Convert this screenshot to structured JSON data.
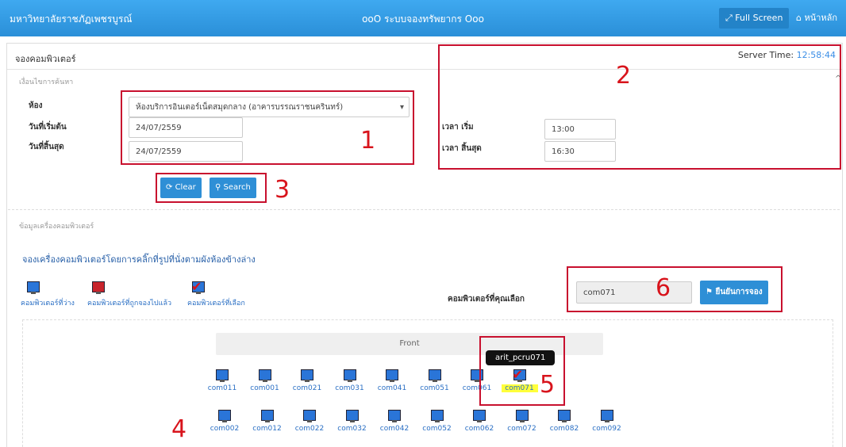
{
  "topbar": {
    "brand": "มหาวิทยาลัยราชภัฏเพชรบูรณ์",
    "title": "ooO ระบบจองทรัพยากร Ooo",
    "fullscreen": "Full Screen",
    "home": "หน้าหลัก",
    "color": "#3399e8"
  },
  "panel": {
    "heading": "จองคอมพิวเตอร์",
    "server_label": "Server Time:",
    "server_time": "12:58:44"
  },
  "search": {
    "section_title": "เงื่อนไขการค้นหา",
    "room_label": "ห้อง",
    "room_value": "ห้องบริการอินเตอร์เน็ตสมุดกลาง (อาคารบรรณราชนครินทร์)",
    "start_date_label": "วันที่เริ่มต้น",
    "start_date": "24/07/2559",
    "end_date_label": "วันที่สิ้นสุด",
    "end_date": "24/07/2559",
    "start_time_label": "เวลา เริ่ม",
    "start_time": "13:00",
    "end_time_label": "เวลา สิ้นสุด",
    "end_time": "16:30",
    "clear": "Clear",
    "search": "Search"
  },
  "annotations": [
    "1",
    "2",
    "3",
    "4",
    "5",
    "6"
  ],
  "computers": {
    "section_title": "ข้อมูลเครื่องคอมพิวเตอร์",
    "instruction": "จองเครื่องคอมพิวเตอร์โดยการคลิ๊กที่รูปที่นั่งตามผังห้องข้างล่าง",
    "legend": [
      "คอมพิวเตอร์ที่ว่าง",
      "คอมพิวเตอร์ที่ถูกจองไปแล้ว",
      "คอมพิวเตอร์ที่เลือก"
    ],
    "selected_label": "คอมพิวเตอร์ที่คุณเลือก",
    "selected_value": "com071",
    "confirm": "ยืนยันการจอง",
    "front": "Front",
    "tooltip": "arit_pcru071",
    "row1": [
      "com011",
      "com001",
      "com021",
      "com031",
      "com041",
      "com051",
      "com061",
      "com071"
    ],
    "row2": [
      "com002",
      "com012",
      "com022",
      "com032",
      "com042",
      "com052",
      "com062",
      "com072",
      "com082",
      "com092"
    ],
    "selected_pc": "com071"
  }
}
